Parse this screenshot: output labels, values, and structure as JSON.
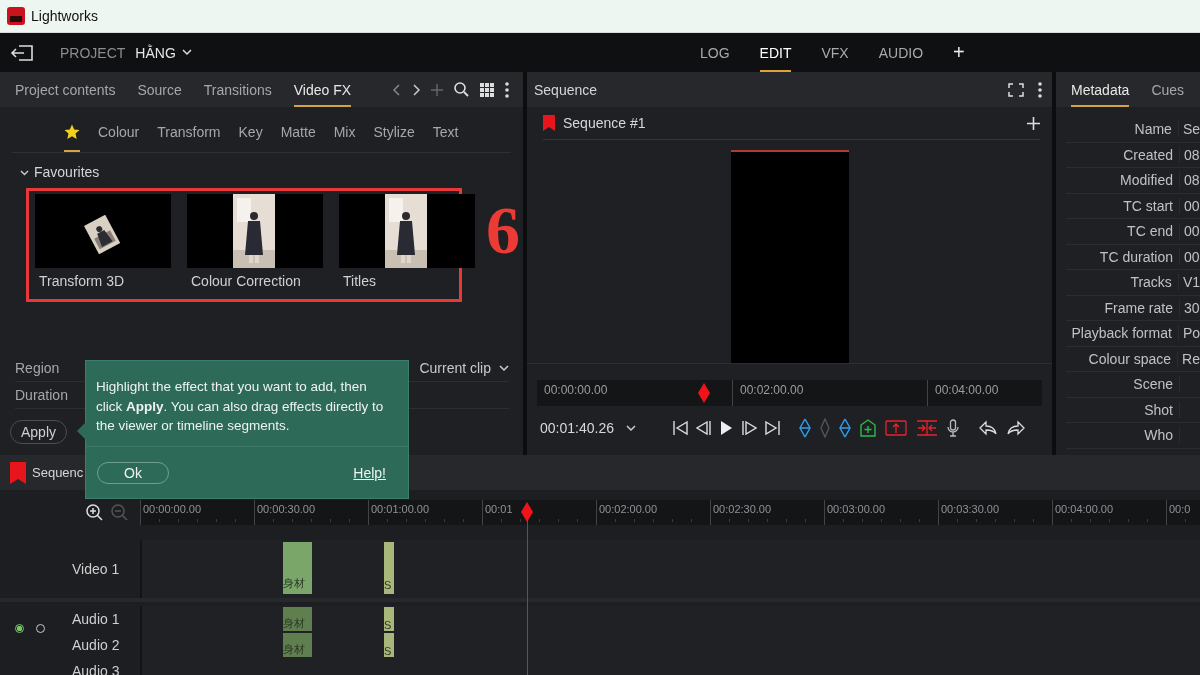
{
  "window": {
    "title": "Lightworks"
  },
  "topbar": {
    "project_label": "PROJECT",
    "project_name": "HẰNG",
    "add_tab": "+",
    "tabs": [
      {
        "label": "LOG",
        "selected": false
      },
      {
        "label": "EDIT",
        "selected": true
      },
      {
        "label": "VFX",
        "selected": false
      },
      {
        "label": "AUDIO",
        "selected": false
      }
    ]
  },
  "browser": {
    "tabs": [
      {
        "label": "Project contents",
        "selected": false
      },
      {
        "label": "Source",
        "selected": false
      },
      {
        "label": "Transitions",
        "selected": false
      },
      {
        "label": "Video FX",
        "selected": true
      }
    ],
    "categories": [
      {
        "kind": "favourites",
        "selected": true
      },
      {
        "kind": "text",
        "label": "Colour",
        "selected": false
      },
      {
        "kind": "text",
        "label": "Transform",
        "selected": false
      },
      {
        "kind": "text",
        "label": "Key",
        "selected": false
      },
      {
        "kind": "text",
        "label": "Matte",
        "selected": false
      },
      {
        "kind": "text",
        "label": "Mix",
        "selected": false
      },
      {
        "kind": "text",
        "label": "Stylize",
        "selected": false
      },
      {
        "kind": "text",
        "label": "Text",
        "selected": false
      }
    ],
    "section": {
      "title": "Favourites",
      "expanded": true
    },
    "effects": [
      {
        "label": "Transform 3D",
        "kind": "picture"
      },
      {
        "label": "Colour Correction",
        "kind": "picture"
      },
      {
        "label": "Titles",
        "kind": "picture"
      }
    ],
    "annotation": "6",
    "fields": [
      {
        "label": "Region",
        "value": "Current clip"
      },
      {
        "label": "Duration"
      }
    ],
    "apply": "Apply"
  },
  "tooltip": {
    "text": "Highlight the effect that you want to add, then click **Apply**. You can also drag effects directly to the viewer or timeline segments.",
    "ok": "Ok",
    "help": "Help!"
  },
  "viewer": {
    "title": "Sequence",
    "sequence": "Sequence #1",
    "scrubber": {
      "ticks": [
        "00:00:00.00",
        "00:02:00.00",
        "00:04:00.00"
      ],
      "level": 0.33
    },
    "timecode": "00:01:40.26"
  },
  "metadata": {
    "tabs": [
      {
        "label": "Metadata",
        "selected": true
      },
      {
        "label": "Cues",
        "selected": false
      }
    ],
    "rows": [
      {
        "label": "Name",
        "value": "Se"
      },
      {
        "label": "Created",
        "value": "08"
      },
      {
        "label": "Modified",
        "value": "08"
      },
      {
        "label": "TC start",
        "value": "00"
      },
      {
        "label": "TC end",
        "value": "00"
      },
      {
        "label": "TC duration",
        "value": "00"
      },
      {
        "label": "Tracks",
        "value": "V1"
      },
      {
        "label": "Frame rate",
        "value": "30"
      },
      {
        "label": "Playback format",
        "value": "Po"
      },
      {
        "label": "Colour space",
        "value": "Re"
      },
      {
        "label": "Scene"
      },
      {
        "label": "Shot"
      },
      {
        "label": "Who"
      }
    ]
  },
  "timeline": {
    "sequence": "Sequenc",
    "playhead": {
      "level": 0.365
    },
    "ruler": [
      "00:00:00.00",
      "00:00:30.00",
      "00:01:00.00",
      "00:01",
      "00:02:00.00",
      "00:02:30.00",
      "00:03:00.00",
      "00:03:30.00",
      "00:04:00.00",
      "00:0"
    ],
    "monitors": [
      {
        "selected": true
      },
      {
        "selected": false
      }
    ],
    "tracks": [
      {
        "kind": "video",
        "name": "Video 1",
        "clips": [
          {
            "label": "身材",
            "color": "#7aa66a"
          },
          {
            "label": "S",
            "color": "#a8b87a"
          }
        ]
      },
      {
        "kind": "audio",
        "name": "Audio 1",
        "clips": [
          {
            "label": "身材",
            "color": "#5f7f4f"
          },
          {
            "label": "S",
            "color": "#a8b87a"
          }
        ]
      },
      {
        "kind": "audio",
        "name": "Audio 2",
        "clips": [
          {
            "label": "身材",
            "color": "#5f7f4f"
          },
          {
            "label": "S",
            "color": "#a8b87a"
          }
        ]
      },
      {
        "kind": "audio",
        "name": "Audio 3"
      }
    ]
  }
}
